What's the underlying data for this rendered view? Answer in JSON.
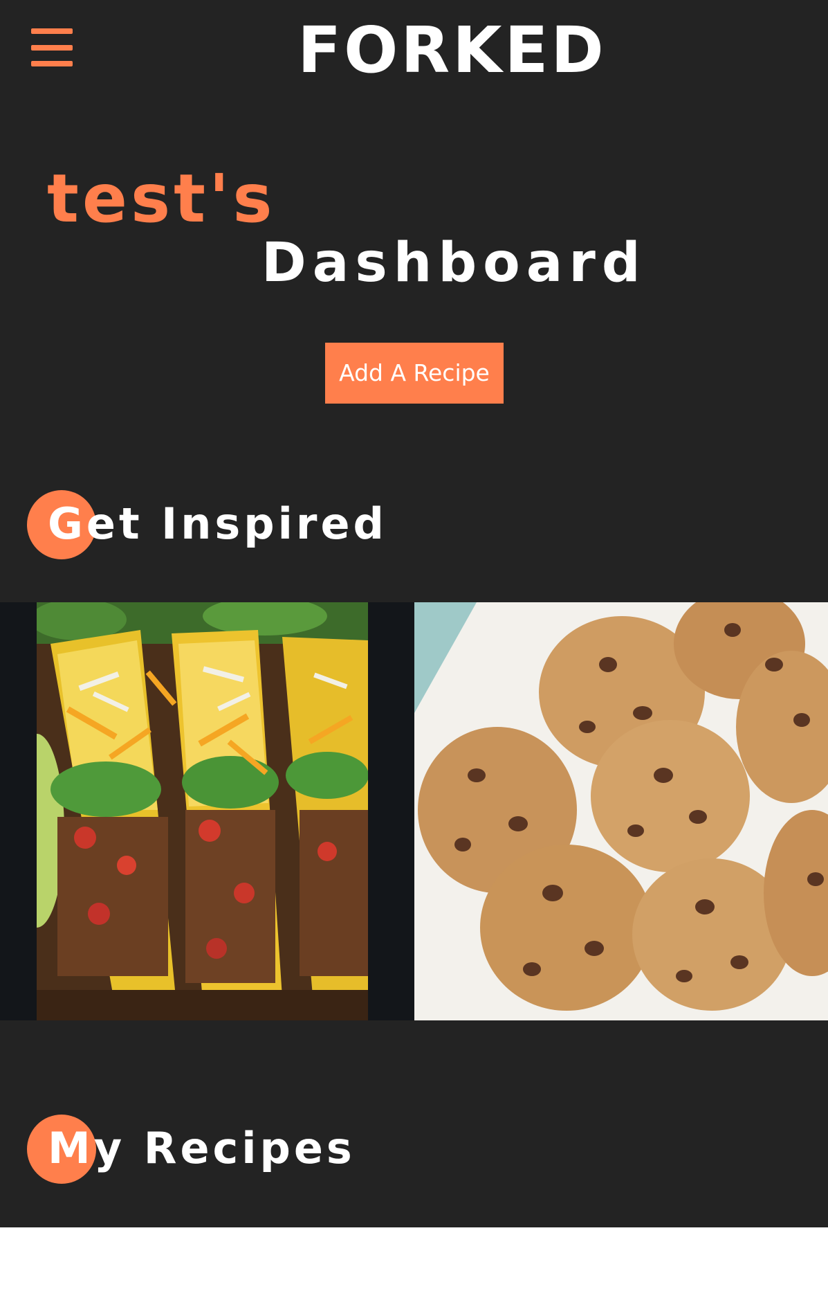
{
  "header": {
    "brand": "FORKED",
    "menu_icon": "hamburger-menu-icon"
  },
  "dashboard": {
    "username": "test's",
    "title": "Dashboard",
    "add_button_label": "Add A Recipe"
  },
  "sections": {
    "inspired_title": "Get Inspired",
    "my_recipes_title": "My Recipes"
  },
  "carousel": {
    "items": [
      {
        "name": "tacos",
        "image_alt": "Tacos"
      },
      {
        "name": "cookies",
        "image_alt": "Chocolate chip cookies"
      }
    ]
  },
  "colors": {
    "background": "#232323",
    "accent": "#ff7f4c",
    "text": "#ffffff",
    "carousel_bg": "#13161a"
  }
}
